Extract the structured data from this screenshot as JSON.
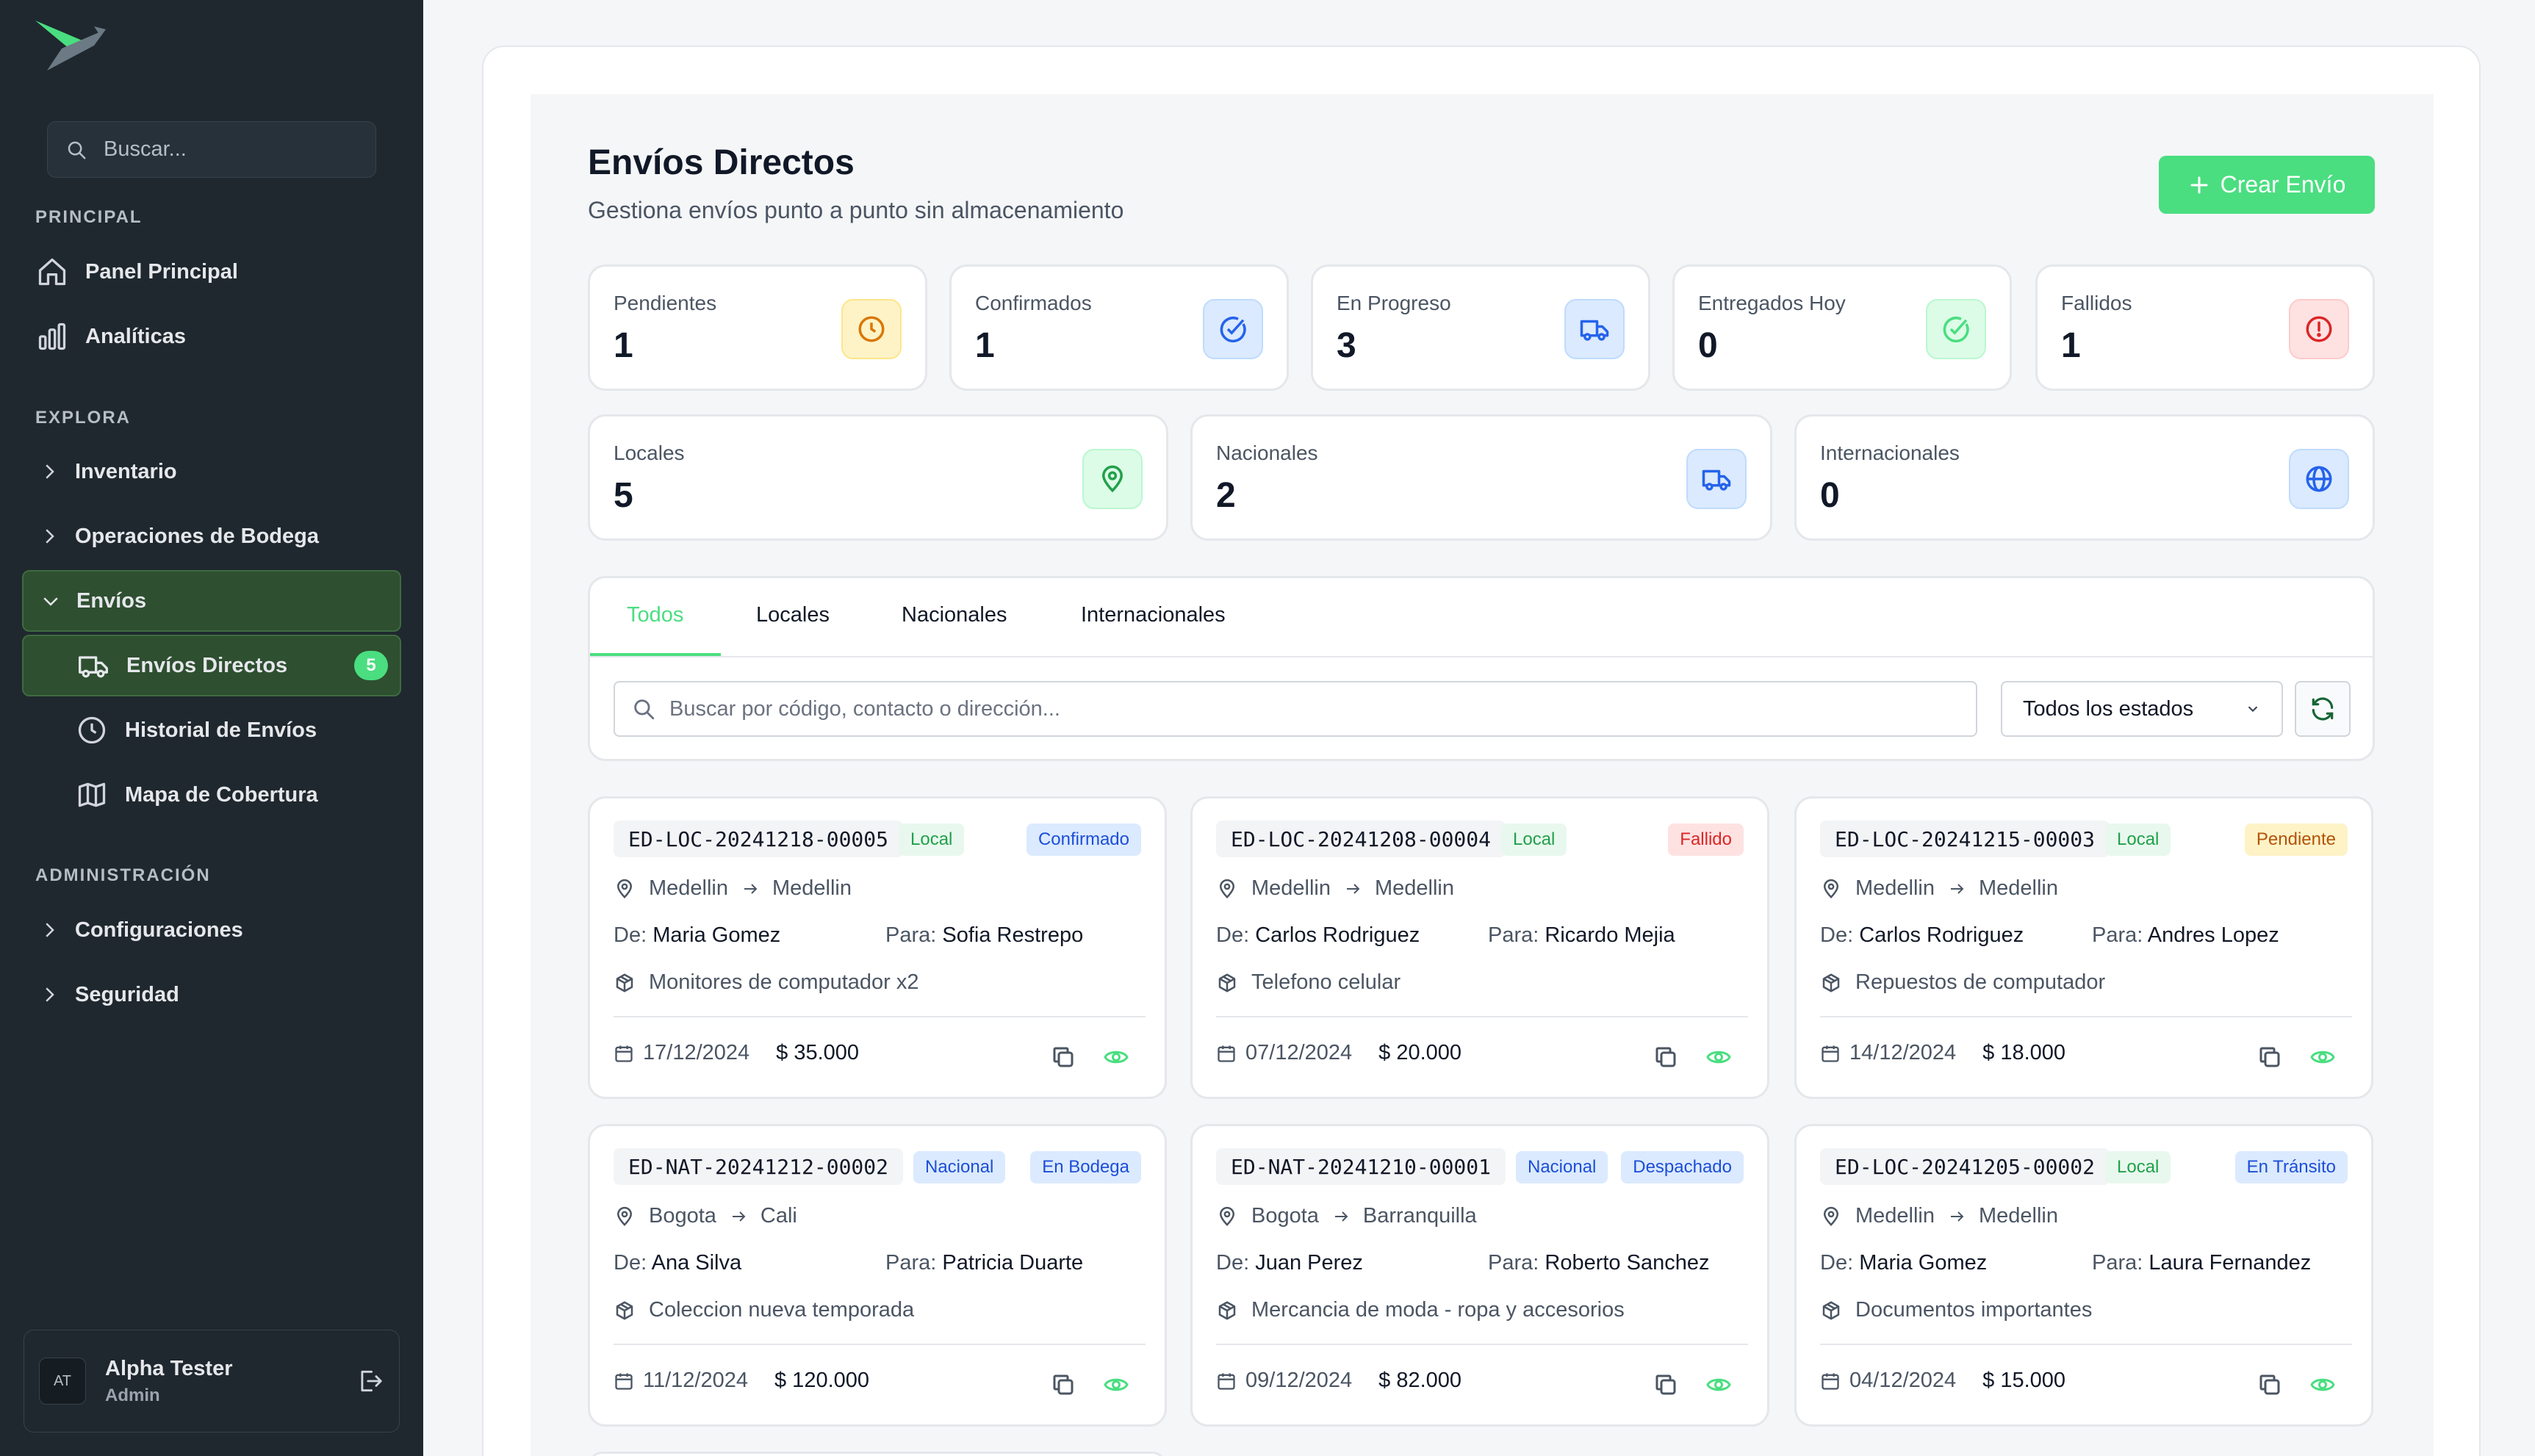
{
  "sidebar": {
    "search_placeholder": "Buscar...",
    "sections": {
      "principal": "PRINCIPAL",
      "explora": "EXPLORA",
      "admin": "ADMINISTRACIÓN"
    },
    "items": {
      "panel": "Panel Principal",
      "analiticas": "Analíticas",
      "inventario": "Inventario",
      "bodega": "Operaciones de Bodega",
      "envios": "Envíos",
      "envios_directos": "Envíos Directos",
      "envios_directos_badge": "5",
      "historial": "Historial de Envíos",
      "mapa": "Mapa de Cobertura",
      "config": "Configuraciones",
      "seguridad": "Seguridad"
    },
    "user": {
      "initials": "AT",
      "name": "Alpha Tester",
      "role": "Admin"
    }
  },
  "header": {
    "title": "Envíos Directos",
    "subtitle": "Gestiona envíos punto a punto sin almacenamiento",
    "create_label": "Crear Envío"
  },
  "stats_row1": [
    {
      "label": "Pendientes",
      "value": "1"
    },
    {
      "label": "Confirmados",
      "value": "1"
    },
    {
      "label": "En Progreso",
      "value": "3"
    },
    {
      "label": "Entregados Hoy",
      "value": "0"
    },
    {
      "label": "Fallidos",
      "value": "1"
    }
  ],
  "stats_row2": [
    {
      "label": "Locales",
      "value": "5"
    },
    {
      "label": "Nacionales",
      "value": "2"
    },
    {
      "label": "Internacionales",
      "value": "0"
    }
  ],
  "tabs": [
    "Todos",
    "Locales",
    "Nacionales",
    "Internacionales"
  ],
  "filters": {
    "search_placeholder": "Buscar por código, contacto o dirección...",
    "status_selected": "Todos los estados"
  },
  "shipments": [
    {
      "code": "ED-LOC-20241218-00005",
      "type": "Local",
      "status": "Confirmado",
      "from": "Medellin",
      "to": "Medellin",
      "de_label": "De:",
      "de": "Maria Gomez",
      "para_label": "Para:",
      "para": "Sofia Restrepo",
      "desc": "Monitores de computador x2",
      "date": "17/12/2024",
      "price": "$ 35.000"
    },
    {
      "code": "ED-LOC-20241208-00004",
      "type": "Local",
      "status": "Fallido",
      "from": "Medellin",
      "to": "Medellin",
      "de_label": "De:",
      "de": "Carlos Rodriguez",
      "para_label": "Para:",
      "para": "Ricardo Mejia",
      "desc": "Telefono celular",
      "date": "07/12/2024",
      "price": "$ 20.000"
    },
    {
      "code": "ED-LOC-20241215-00003",
      "type": "Local",
      "status": "Pendiente",
      "from": "Medellin",
      "to": "Medellin",
      "de_label": "De:",
      "de": "Carlos Rodriguez",
      "para_label": "Para:",
      "para": "Andres Lopez",
      "desc": "Repuestos de computador",
      "date": "14/12/2024",
      "price": "$ 18.000"
    },
    {
      "code": "ED-NAT-20241212-00002",
      "type": "Nacional",
      "status": "En Bodega",
      "from": "Bogota",
      "to": "Cali",
      "de_label": "De:",
      "de": "Ana Silva",
      "para_label": "Para:",
      "para": "Patricia Duarte",
      "desc": "Coleccion nueva temporada",
      "date": "11/12/2024",
      "price": "$ 120.000"
    },
    {
      "code": "ED-NAT-20241210-00001",
      "type": "Nacional",
      "status": "Despachado",
      "from": "Bogota",
      "to": "Barranquilla",
      "de_label": "De:",
      "de": "Juan Perez",
      "para_label": "Para:",
      "para": "Roberto Sanchez",
      "desc": "Mercancia de moda - ropa y accesorios",
      "date": "09/12/2024",
      "price": "$ 82.000"
    },
    {
      "code": "ED-LOC-20241205-00002",
      "type": "Local",
      "status": "En Tránsito",
      "from": "Medellin",
      "to": "Medellin",
      "de_label": "De:",
      "de": "Maria Gomez",
      "para_label": "Para:",
      "para": "Laura Fernandez",
      "desc": "Documentos importantes",
      "date": "04/12/2024",
      "price": "$ 15.000"
    }
  ],
  "colors": {
    "accent": "#4ade80",
    "sidebar_bg": "#1f282e",
    "active_bg": "#2e4f30"
  }
}
